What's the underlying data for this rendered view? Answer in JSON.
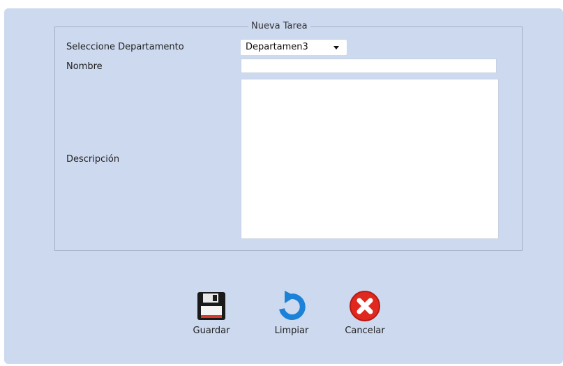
{
  "form": {
    "legend": "Nueva Tarea",
    "department_label": "Seleccione Departamento",
    "department_selected": "Departamen3",
    "name_label": "Nombre",
    "name_value": "",
    "description_label": "Descripción",
    "description_value": ""
  },
  "actions": {
    "save_label": "Guardar",
    "clear_label": "Limpiar",
    "cancel_label": "Cancelar"
  },
  "icons": {
    "save": "floppy-disk-icon",
    "clear": "undo-arrow-icon",
    "cancel": "red-x-circle-icon"
  },
  "colors": {
    "panel_bg": "#ccd9ef",
    "fieldset_border": "#a4b0c3",
    "clear_icon": "#1b82d8",
    "cancel_icon": "#e0281f"
  }
}
